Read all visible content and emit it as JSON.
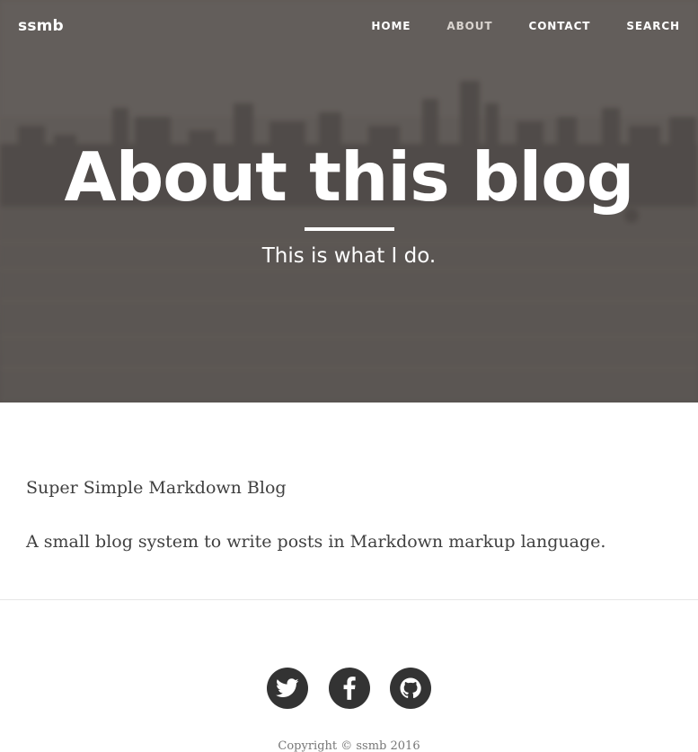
{
  "nav": {
    "brand": "ssmb",
    "items": [
      {
        "label": "HOME"
      },
      {
        "label": "ABOUT",
        "active": true
      },
      {
        "label": "CONTACT"
      },
      {
        "label": "SEARCH"
      }
    ]
  },
  "hero": {
    "title": "About this blog",
    "subtitle": "This is what I do."
  },
  "content": {
    "paragraphs": [
      "Super Simple Markdown Blog",
      "A small blog system to write posts in Markdown markup language."
    ]
  },
  "footer": {
    "social": [
      {
        "icon": "twitter-icon"
      },
      {
        "icon": "facebook-icon"
      },
      {
        "icon": "github-icon"
      }
    ],
    "copyright": "Copyright © ssmb 2016"
  },
  "colors": {
    "hero_tint": "#6b6662",
    "text": "#404040",
    "social_bg": "#333333",
    "copyright": "#777777"
  }
}
